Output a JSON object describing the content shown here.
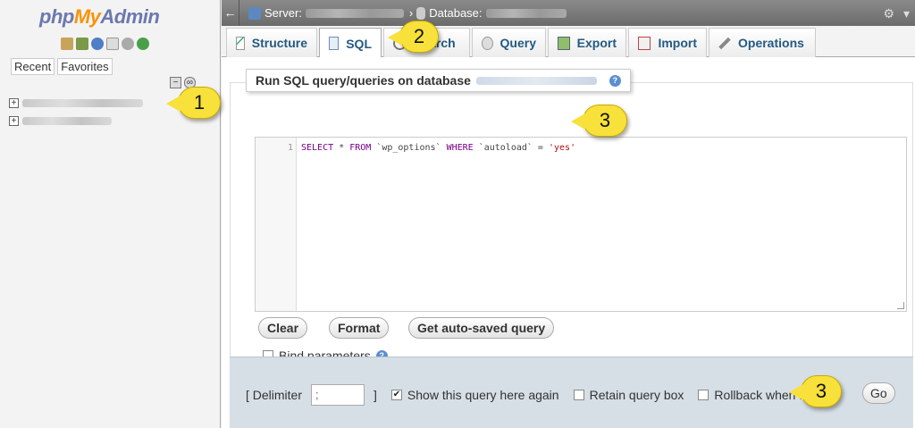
{
  "app": {
    "logo_php": "php",
    "logo_my": "My",
    "logo_admin": "Admin"
  },
  "sidebar": {
    "tabs": [
      "Recent",
      "Favorites"
    ],
    "quick_icons": [
      "home-icon",
      "exit-icon",
      "help-icon",
      "docs-icon",
      "settings-icon",
      "reload-icon"
    ]
  },
  "topbar": {
    "server_label": "Server:",
    "database_label": "Database:",
    "separator": "›"
  },
  "tabs": [
    {
      "label": "Structure",
      "icon": "structure-icon"
    },
    {
      "label": "SQL",
      "icon": "sql-icon"
    },
    {
      "label": "Search",
      "icon": "search-icon"
    },
    {
      "label": "Query",
      "icon": "query-icon"
    },
    {
      "label": "Export",
      "icon": "export-icon"
    },
    {
      "label": "Import",
      "icon": "import-icon"
    },
    {
      "label": "Operations",
      "icon": "operations-icon"
    }
  ],
  "sql_panel": {
    "legend": "Run SQL query/queries on database",
    "line_number": "1",
    "query": {
      "kw1": "SELECT",
      "part1": " * ",
      "kw2": "FROM",
      "part2": " `wp_options` ",
      "kw3": "WHERE",
      "part3": " `autoload` = ",
      "str": "'yes'"
    },
    "buttons": {
      "clear": "Clear",
      "format": "Format",
      "autosaved": "Get auto-saved query"
    },
    "bind_parameters": "Bind parameters"
  },
  "footer": {
    "delimiter_open": "[ Delimiter",
    "delimiter_value": ";",
    "delimiter_close": "]",
    "show_query": "Show this query here again",
    "show_query_checked": true,
    "retain_query_box": "Retain query box",
    "rollback": "Rollback when finish",
    "go": "Go"
  },
  "annotations": [
    "1",
    "2",
    "3",
    "3"
  ]
}
